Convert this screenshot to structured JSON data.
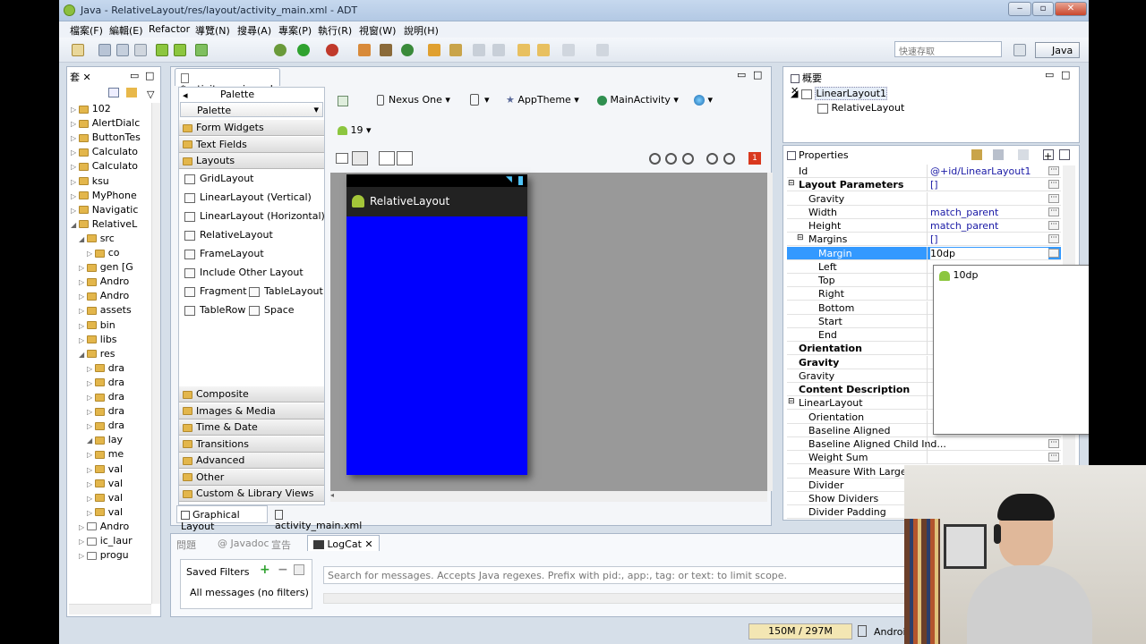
{
  "window": {
    "title": "Java - RelativeLayout/res/layout/activity_main.xml - ADT"
  },
  "menu": [
    "檔案(F)",
    "編輯(E)",
    "Refactor",
    "導覽(N)",
    "搜尋(A)",
    "專案(P)",
    "執行(R)",
    "視窗(W)",
    "說明(H)"
  ],
  "quick_access": {
    "placeholder": "快速存取"
  },
  "perspective": {
    "label": "Java"
  },
  "explorer": {
    "tab": "套",
    "items": [
      "102",
      "AlertDialc",
      "ButtonTes",
      "Calculato",
      "Calculato",
      "ksu",
      "MyPhone",
      "Navigatic",
      "RelativeL",
      "src",
      "co",
      "gen [G",
      "Andro",
      "Andro",
      "assets",
      "bin",
      "libs",
      "res",
      "dra",
      "dra",
      "dra",
      "dra",
      "dra",
      "lay",
      "me",
      "val",
      "val",
      "val",
      "val",
      "Andro",
      "ic_laur",
      "progu"
    ]
  },
  "editor": {
    "tab": "*activity_main.xml",
    "palette": {
      "header": "Palette",
      "dropdown": "Palette",
      "categories_top": [
        "Form Widgets",
        "Text Fields",
        "Layouts"
      ],
      "layout_items": [
        "GridLayout",
        "LinearLayout (Vertical)",
        "LinearLayout (Horizontal)",
        "RelativeLayout",
        "FrameLayout",
        "Include Other Layout",
        "Fragment",
        "TableLayout",
        "TableRow",
        "Space"
      ],
      "categories_bottom": [
        "Composite",
        "Images & Media",
        "Time & Date",
        "Transitions",
        "Advanced",
        "Other",
        "Custom & Library Views"
      ]
    },
    "toolbar": {
      "device": "Nexus One",
      "theme": "AppTheme",
      "activity": "MainActivity",
      "api": "19",
      "badge": "1"
    },
    "phone": {
      "app_title": "RelativeLayout",
      "content_color": "#0000ff"
    },
    "bottom_tabs": [
      "Graphical Layout",
      "activity_main.xml"
    ]
  },
  "outline": {
    "tab": "概要",
    "items": [
      "LinearLayout1",
      "RelativeLayout"
    ]
  },
  "properties": {
    "title": "Properties",
    "rows": [
      {
        "k": "Id",
        "v": "@+id/LinearLayout1",
        "bold": false
      },
      {
        "k": "Layout Parameters",
        "v": "[]",
        "bold": true
      },
      {
        "k": "Gravity",
        "v": "",
        "bold": false
      },
      {
        "k": "Width",
        "v": "match_parent",
        "bold": false
      },
      {
        "k": "Height",
        "v": "match_parent",
        "bold": false
      },
      {
        "k": "Margins",
        "v": "[]",
        "bold": false
      },
      {
        "k": "Margin",
        "v": "10dp",
        "bold": false
      },
      {
        "k": "Left",
        "v": "",
        "bold": false
      },
      {
        "k": "Top",
        "v": "",
        "bold": false
      },
      {
        "k": "Right",
        "v": "",
        "bold": false
      },
      {
        "k": "Bottom",
        "v": "",
        "bold": false
      },
      {
        "k": "Start",
        "v": "",
        "bold": false
      },
      {
        "k": "End",
        "v": "",
        "bold": false
      },
      {
        "k": "Orientation",
        "v": "",
        "bold": true
      },
      {
        "k": "Gravity",
        "v": "",
        "bold": true
      },
      {
        "k": "Gravity",
        "v": "",
        "bold": false
      },
      {
        "k": "Content Description",
        "v": "",
        "bold": true
      },
      {
        "k": "LinearLayout",
        "v": "",
        "bold": false
      },
      {
        "k": "Orientation",
        "v": "",
        "bold": false
      },
      {
        "k": "Baseline Aligned",
        "v": "",
        "bold": false
      },
      {
        "k": "Baseline Aligned Child Ind...",
        "v": "",
        "bold": false
      },
      {
        "k": "Weight Sum",
        "v": "",
        "bold": false
      },
      {
        "k": "Measure With Largest C",
        "v": "",
        "bold": false
      },
      {
        "k": "Divider",
        "v": "",
        "bold": false
      },
      {
        "k": "Show Dividers",
        "v": "",
        "bold": false
      },
      {
        "k": "Divider Padding",
        "v": "",
        "bold": false
      }
    ],
    "popup": {
      "value": "10dp"
    }
  },
  "console": {
    "tabs": [
      "問題",
      "Javadoc",
      "宣告",
      "LogCat"
    ],
    "saved_filters": "Saved Filters",
    "all_messages": "All messages (no filters)",
    "search_placeholder": "Search for messages. Accepts Java regexes. Prefix with pid:, app:, tag: or text: to limit scope."
  },
  "status": {
    "memory": "150M / 297M",
    "right": "Androi"
  }
}
